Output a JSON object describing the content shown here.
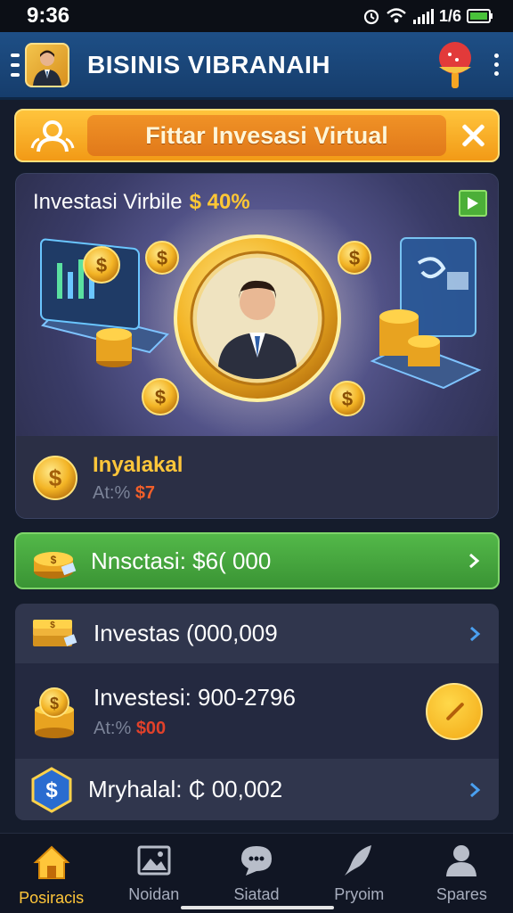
{
  "status_bar": {
    "time": "9:36",
    "carrier": "1/6",
    "signal_text": ""
  },
  "app_bar": {
    "title": "BISINIS VIBRANAIH"
  },
  "banner": {
    "label": "Fittar Invesasi Virtual"
  },
  "hero": {
    "title": "Investasi Virbile",
    "percent": "$ 40%",
    "item_name": "Inyalakal",
    "item_meta_prefix": "At:%",
    "item_meta_value": "$7"
  },
  "primary_action": {
    "label": "Nnsctasi: $6( 000"
  },
  "list": {
    "items": [
      {
        "label": "Investas (000,009"
      },
      {
        "label": "Investesi:  900-2796",
        "meta_prefix": "At:%",
        "meta_value": "$00"
      },
      {
        "label": "Mryhalal: ₵ 00,002"
      }
    ]
  },
  "bottom_nav": {
    "items": [
      {
        "label": "Posiracis",
        "icon": "home-icon",
        "active": true
      },
      {
        "label": "Noidan",
        "icon": "image-icon",
        "active": false
      },
      {
        "label": "Siatad",
        "icon": "chat-icon",
        "active": false
      },
      {
        "label": "Pryoim",
        "icon": "feather-icon",
        "active": false
      },
      {
        "label": "Spares",
        "icon": "person-icon",
        "active": false
      }
    ]
  },
  "colors": {
    "accent": "#ffc63a",
    "green": "#4caf38",
    "app_bar": "#1e4f86",
    "background": "#151c2c"
  }
}
